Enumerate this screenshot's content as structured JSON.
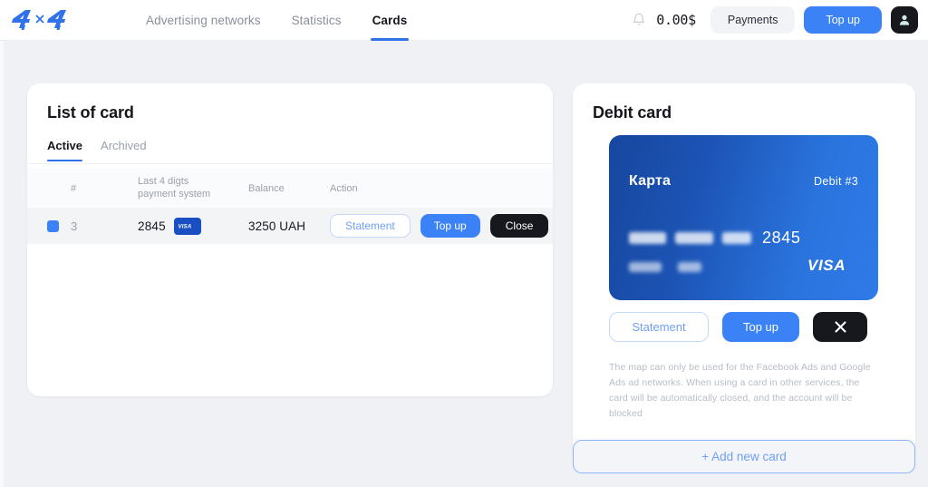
{
  "brand": {
    "logo_text": "4 x 4",
    "accent_blue": "#3b82f6",
    "dark": "#16181d"
  },
  "header": {
    "nav": [
      {
        "label": "Advertising networks",
        "active": false
      },
      {
        "label": "Statistics",
        "active": false
      },
      {
        "label": "Cards",
        "active": true
      }
    ],
    "bell_icon": "bell-icon",
    "balance": "0.00$",
    "payments_label": "Payments",
    "topup_label": "Top up",
    "avatar_icon": "user-icon"
  },
  "card_list": {
    "title": "List of card",
    "tabs": [
      {
        "label": "Active",
        "active": true
      },
      {
        "label": "Archived",
        "active": false
      }
    ],
    "columns": {
      "check": "",
      "num": "#",
      "last4": "Last 4 digts\npayment system",
      "balance": "Balance",
      "action": "Action"
    },
    "rows": [
      {
        "selected": true,
        "num": "3",
        "digits": "2845",
        "payment_system": "VISA",
        "balance": "3250 UAH",
        "statement_label": "Statement",
        "topup_label": "Top up",
        "close_label": "Close"
      }
    ]
  },
  "debit": {
    "title": "Debit card",
    "card": {
      "label": "Карта",
      "id": "Debit #3",
      "masked_groups": [
        "",
        "",
        ""
      ],
      "last4": "2845",
      "payment_system": "VISA"
    },
    "actions": {
      "statement_label": "Statement",
      "topup_label": "Top up",
      "close_icon": "close-icon"
    },
    "disclaimer": "The map can only be used for the Facebook Ads and Google Ads ad networks. When using a card in other services, the card will be automatically closed, and the account will be blocked"
  },
  "add_card": {
    "label": "+ Add new card"
  }
}
